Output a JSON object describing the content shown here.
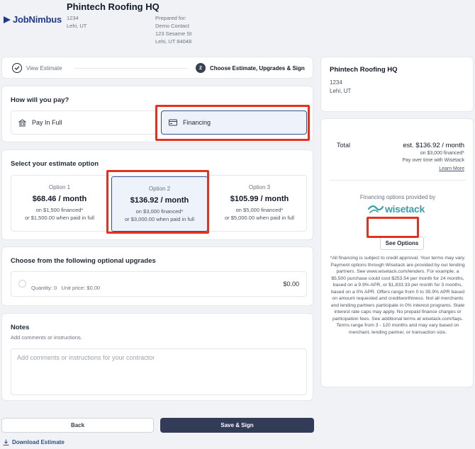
{
  "header": {
    "logo_text": "JobNimbus",
    "company": "Phintech Roofing HQ",
    "address_line1": "1234",
    "address_line2": "Lehi, UT",
    "prepared_label": "Prepared for:",
    "prepared_name": "Demo Contact",
    "prepared_street": "123 Sesame St",
    "prepared_city": "Lehi, UT 84048"
  },
  "steps": {
    "step1_label": "View Estimate",
    "step2_number": "2",
    "step2_label": "Choose Estimate, Upgrades & Sign"
  },
  "payment": {
    "title": "How will you pay?",
    "pay_in_full": "Pay In Full",
    "financing": "Financing"
  },
  "estimate": {
    "title": "Select your estimate option",
    "options": [
      {
        "name": "Option 1",
        "price": "$68.46 / month",
        "financed": "on $1,500 financed*",
        "paid_full": "or $1,500.00 when paid in full"
      },
      {
        "name": "Option 2",
        "price": "$136.92 / month",
        "financed": "on $3,000 financed*",
        "paid_full": "or $3,000.00 when paid in full"
      },
      {
        "name": "Option 3",
        "price": "$105.99 / month",
        "financed": "on $5,000 financed*",
        "paid_full": "or $5,000.00 when paid in full"
      }
    ]
  },
  "upgrades": {
    "title": "Choose from the following optional upgrades",
    "quantity": "Quantity: 0",
    "unit_price": "Unit price: $0.00",
    "price": "$0.00"
  },
  "notes": {
    "title": "Notes",
    "subtitle": "Add comments or instructions.",
    "placeholder": "Add comments or instructions for your contractor"
  },
  "buttons": {
    "back": "Back",
    "save_sign": "Save & Sign",
    "download": "Download Estimate"
  },
  "summary": {
    "company": "Phintech Roofing HQ",
    "address_line1": "1234",
    "address_line2": "Lehi, UT"
  },
  "financing_panel": {
    "total_label": "Total",
    "total_value": "est. $136.92 / month",
    "total_financed": "on $3,000 financed*",
    "total_note": "Pay over time with Wisetack",
    "learn_more": "Learn More",
    "provided_by": "Financing options provided by",
    "provider": "wisetack",
    "see_options": "See Options",
    "disclaimer": "*All financing is subject to credit approval. Your terms may vary. Payment options through Wisetack are provided by our lending partners. See www.wisetack.com/lenders. For example, a $5,500 purchase could cost $253.54 per month for 24 months, based on a 9.9% APR, or $1,833.33 per month for 3 months, based on a 0% APR. Offers range from 0 to 35.9% APR based on amount requested and creditworthiness. Not all merchants and lending partners participate in 0% interest programs. State interest rate caps may apply. No prepaid finance charges or participation fees. See additional terms at wisetack.com/faqs. Terms range from 3 - 120 months and may vary based on merchant, lending partner, or transaction size."
  },
  "colors": {
    "accent": "#374e8a",
    "highlight": "#e3321f",
    "primary_button": "#323c57",
    "wisetack": "#3aa0a8"
  }
}
